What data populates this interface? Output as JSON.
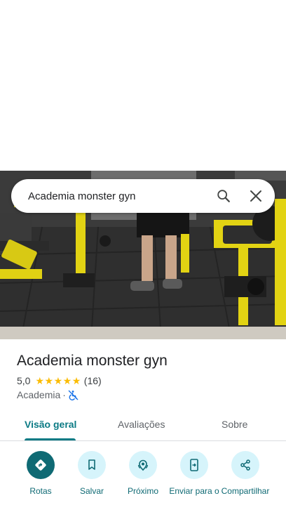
{
  "search": {
    "query": "Academia monster gyn"
  },
  "place": {
    "name": "Academia monster gyn",
    "rating": "5,0",
    "stars": 5,
    "review_count": "(16)",
    "category": "Academia",
    "separator": "·"
  },
  "tabs": [
    {
      "label": "Visão geral",
      "active": true
    },
    {
      "label": "Avaliações",
      "active": false
    },
    {
      "label": "Sobre",
      "active": false
    }
  ],
  "actions": [
    {
      "label": "Rotas",
      "icon": "directions-icon"
    },
    {
      "label": "Salvar",
      "icon": "bookmark-icon"
    },
    {
      "label": "Próximo",
      "icon": "nearby-icon"
    },
    {
      "label": "Enviar para o",
      "icon": "send-to-phone-icon"
    },
    {
      "label": "Compartilhar",
      "icon": "share-icon"
    }
  ],
  "colors": {
    "accent": "#0b7a84",
    "action_fill": "#d6f4fb",
    "star": "#fbbc04",
    "equipment_yellow": "#e4d313"
  }
}
